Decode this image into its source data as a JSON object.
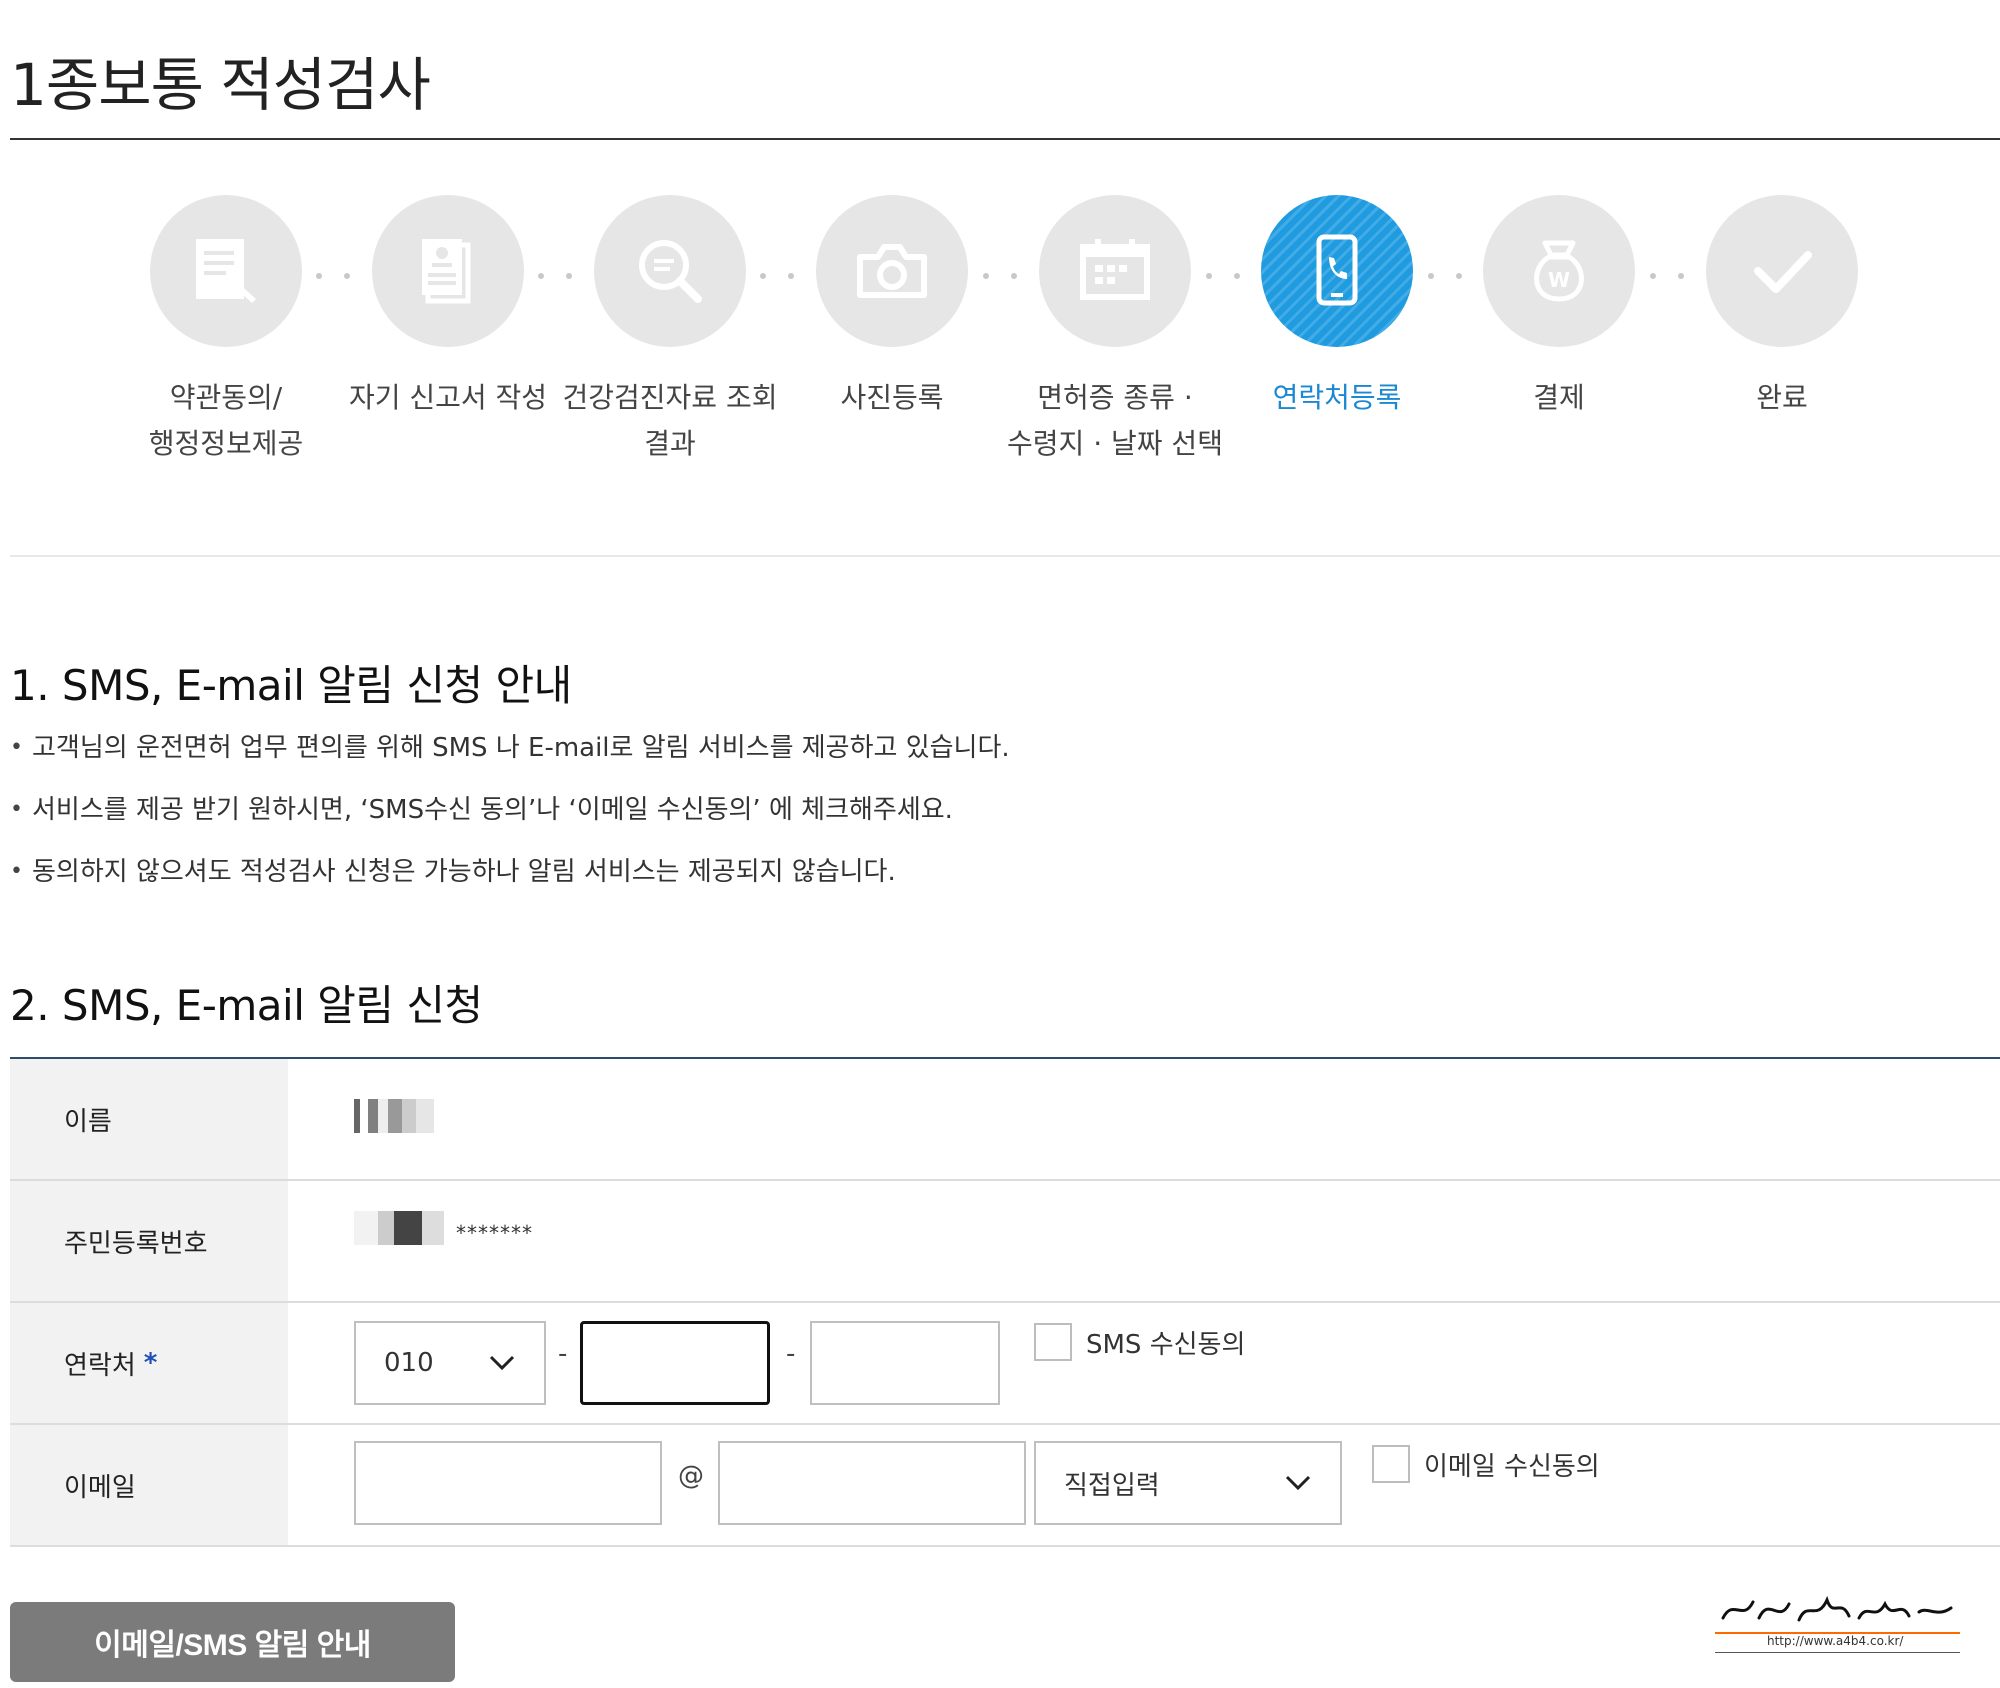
{
  "page": {
    "title": "1종보통 적성검사"
  },
  "steps": [
    {
      "label": "약관동의/\n행정정보제공",
      "icon": "document-edit-icon",
      "active": false
    },
    {
      "label": "자기 신고서 작성",
      "icon": "id-document-icon",
      "active": false
    },
    {
      "label": "건강검진자료 조회\n결과",
      "icon": "search-document-icon",
      "active": false
    },
    {
      "label": "사진등록",
      "icon": "camera-icon",
      "active": false
    },
    {
      "label": "면허증 종류 ·\n수령지 · 날짜 선택",
      "icon": "calendar-icon",
      "active": false
    },
    {
      "label": "연락처등록",
      "icon": "phone-icon",
      "active": true
    },
    {
      "label": "결제",
      "icon": "money-bag-icon",
      "active": false
    },
    {
      "label": "완료",
      "icon": "check-icon",
      "active": false
    }
  ],
  "section1": {
    "heading": "1. SMS, E-mail 알림 신청 안내",
    "bullets": [
      "고객님의 운전면허 업무 편의를 위해 SMS 나 E-mail로 알림 서비스를 제공하고 있습니다.",
      "서비스를 제공 받기 원하시면, ‘SMS수신 동의’나 ‘이메일 수신동의’ 에 체크해주세요.",
      "동의하지 않으셔도 적성검사 신청은 가능하나 알림 서비스는 제공되지 않습니다."
    ]
  },
  "section2": {
    "heading": "2. SMS, E-mail 알림 신청",
    "name_label": "이름",
    "rrn_label": "주민등록번호",
    "rrn_masked": "*******",
    "phone_label": "연락처",
    "phone_required": "*",
    "phone_prefix": "010",
    "phone_sep": "-",
    "phone_mid": "",
    "phone_last": "",
    "sms_consent": "SMS 수신동의",
    "email_label": "이메일",
    "email_user": "",
    "email_at": "@",
    "email_domain": "",
    "email_domain_select": "직접입력",
    "email_consent": "이메일 수신동의"
  },
  "button": {
    "notice": "이메일/SMS 알림 안내"
  },
  "watermark": {
    "url": "http://www.a4b4.co.kr/"
  },
  "colors": {
    "accent": "#1f9be0",
    "active_label": "#1a88d3",
    "header_rule": "#2d4a6b",
    "button": "#7b7b7b"
  }
}
